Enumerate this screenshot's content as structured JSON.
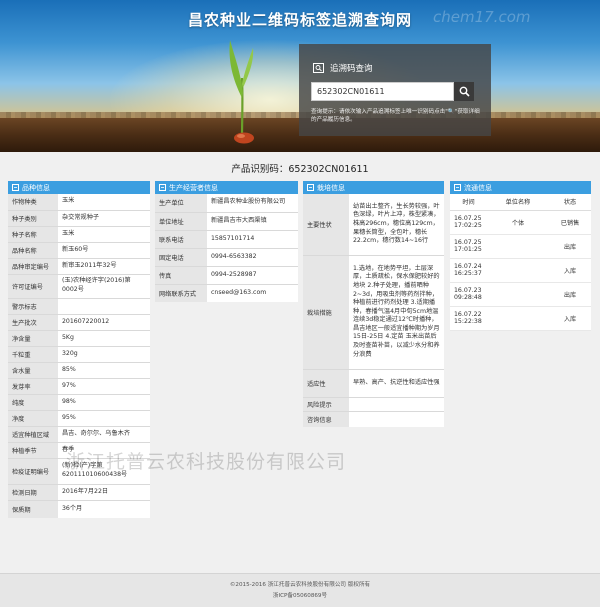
{
  "header": {
    "title": "昌农种业二维码标签追溯查询网",
    "watermark": "chem17.com"
  },
  "query": {
    "label": "追溯码查询",
    "input_value": "652302CN01611",
    "tip": "查询提示：请依次输入产品追溯标签上唯一识别码点击\"🔍\"获取详细的产品履历信息。"
  },
  "product_code": "产品识别码：652302CN01611",
  "variety": {
    "title": "品种信息",
    "rows": [
      {
        "k": "作物种类",
        "v": "玉米"
      },
      {
        "k": "种子类别",
        "v": "杂交常规种子"
      },
      {
        "k": "种子名称",
        "v": "玉米"
      },
      {
        "k": "品种名称",
        "v": "新玉60号"
      },
      {
        "k": "品种审定编号",
        "v": "新审玉2011年32号"
      },
      {
        "k": "许可证编号",
        "v": "(玉)农种经许字(2016)第0002号"
      },
      {
        "k": "警示标志",
        "v": ""
      },
      {
        "k": "生产批次",
        "v": "201607220012"
      },
      {
        "k": "净含量",
        "v": "5Kg"
      },
      {
        "k": "千粒重",
        "v": "320g"
      },
      {
        "k": "含水量",
        "v": "85%"
      },
      {
        "k": "发芽率",
        "v": "97%"
      },
      {
        "k": "纯度",
        "v": "98%"
      },
      {
        "k": "净度",
        "v": "95%"
      },
      {
        "k": "适宜种植区域",
        "v": "昌吉、奇尔尔、乌鲁木齐"
      },
      {
        "k": "种植季节",
        "v": "春季"
      },
      {
        "k": "检疫证明编号",
        "v": "(新)检(产)字第620111010600438号"
      },
      {
        "k": "检测日期",
        "v": "2016年7月22日"
      },
      {
        "k": "保质期",
        "v": "36个月"
      }
    ]
  },
  "operator": {
    "title": "生产经营者信息",
    "rows": [
      {
        "k": "生产单位",
        "v": "新疆昌农种业股份有限公司"
      },
      {
        "k": "单位地址",
        "v": "新疆昌吉市大西渠镇"
      },
      {
        "k": "联系电话",
        "v": "15857101714"
      },
      {
        "k": "固定电话",
        "v": "0994-6563382"
      },
      {
        "k": "传真",
        "v": "0994-2528987"
      },
      {
        "k": "网络联系方式",
        "v": "cnseed@163.com"
      }
    ]
  },
  "cultivation": {
    "title": "栽培信息",
    "rows": [
      {
        "k": "主要性状",
        "v": "幼苗出土整齐，生长势较强，叶色深绿，叶片上冲，株型紧凑，株高296cm，穗位高129cm，果穗长筒型，全包叶，穗长22.2cm，穗行数14~16行"
      },
      {
        "k": "栽培措施",
        "v": "1.选地，在地势平坦，土层深厚，土质疏松，保水保肥较好的地块 2.种子处理，播前晒种2~3d，用吸虫剂等药剂拌种，种植前进行药剂处理 3.适期播种，春播气温4月中旬5cm地温连续3d稳定通过12℃时播种，昌吉地区一般适宜播种期为岁月15日-25日 4.定苗 玉米出苗后及时查苗补苗，以减少水分和养分浪费"
      },
      {
        "k": "适应性",
        "v": "早熟、高产、抗逆性和适应性强"
      },
      {
        "k": "风险提示",
        "v": ""
      },
      {
        "k": "咨询信息",
        "v": ""
      }
    ]
  },
  "circulation": {
    "title": "流通信息",
    "headers": [
      "时间",
      "单位名称",
      "状态"
    ],
    "rows": [
      {
        "time": "16.07.25 17:02:25",
        "unit": "个体",
        "status": "已销售"
      },
      {
        "time": "16.07.25 17:01:25",
        "unit": "",
        "status": "出库"
      },
      {
        "time": "16.07.24 16:25:37",
        "unit": "",
        "status": "入库"
      },
      {
        "time": "16.07.23 09:28:48",
        "unit": "",
        "status": "出库"
      },
      {
        "time": "16.07.22 15:22:38",
        "unit": "",
        "status": "入库"
      }
    ]
  },
  "overlay_watermark": "浙江托普云农科技股份有限公司",
  "footer": {
    "copyright": "©2015-2016 浙江托普云农科技股份有限公司 版权所有",
    "icp": "浙ICP备05060869号"
  }
}
